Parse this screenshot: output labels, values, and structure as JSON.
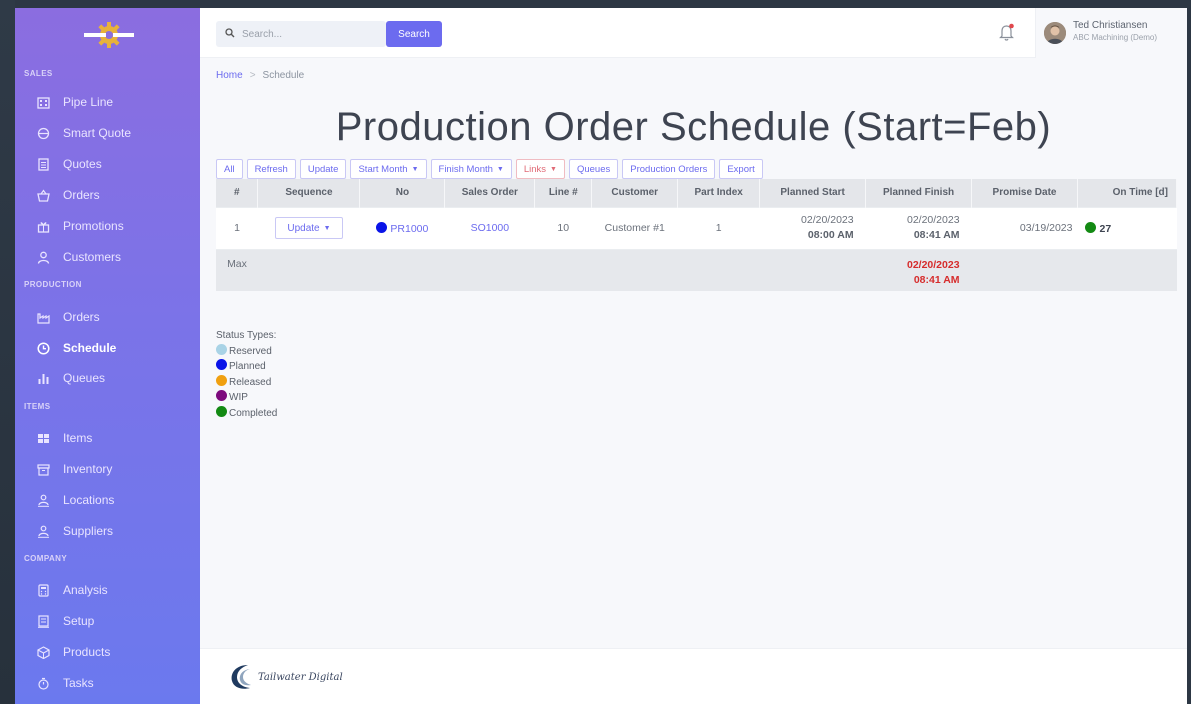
{
  "sidebar": {
    "sections": [
      {
        "label": "SALES"
      },
      {
        "label": "PRODUCTION"
      },
      {
        "label": "ITEMS"
      },
      {
        "label": "COMPANY"
      }
    ],
    "items": [
      {
        "label": "Pipe Line",
        "icon": "building-icon"
      },
      {
        "label": "Smart Quote",
        "icon": "smart-quote-icon"
      },
      {
        "label": "Quotes",
        "icon": "document-icon"
      },
      {
        "label": "Orders",
        "icon": "basket-icon"
      },
      {
        "label": "Promotions",
        "icon": "gift-icon"
      },
      {
        "label": "Customers",
        "icon": "person-icon"
      },
      {
        "label": "Orders",
        "icon": "factory-icon"
      },
      {
        "label": "Schedule",
        "icon": "clock-icon",
        "active": true
      },
      {
        "label": "Queues",
        "icon": "bar-chart-icon"
      },
      {
        "label": "Items",
        "icon": "boxes-icon"
      },
      {
        "label": "Inventory",
        "icon": "archive-icon"
      },
      {
        "label": "Locations",
        "icon": "location-person-icon"
      },
      {
        "label": "Suppliers",
        "icon": "supplier-icon"
      },
      {
        "label": "Analysis",
        "icon": "calculator-icon"
      },
      {
        "label": "Setup",
        "icon": "setup-icon"
      },
      {
        "label": "Products",
        "icon": "cube-icon"
      },
      {
        "label": "Tasks",
        "icon": "timer-icon"
      }
    ]
  },
  "header": {
    "search_placeholder": "Search...",
    "search_button": "Search",
    "user_name": "Ted Christiansen",
    "user_org": "ABC Machining (Demo)"
  },
  "breadcrumb": {
    "home": "Home",
    "sep": ">",
    "current": "Schedule"
  },
  "page_title": "Production Order Schedule (Start=Feb)",
  "toolbar": {
    "all": "All",
    "refresh": "Refresh",
    "update": "Update",
    "start_month": "Start Month",
    "finish_month": "Finish Month",
    "links": "Links",
    "queues": "Queues",
    "production_orders": "Production Orders",
    "export": "Export"
  },
  "table": {
    "columns": [
      "#",
      "Sequence",
      "No",
      "Sales Order",
      "Line #",
      "Customer",
      "Part Index",
      "Planned Start",
      "Planned Finish",
      "Promise Date",
      "On Time [d]"
    ],
    "rows": [
      {
        "num": "1",
        "sequence_button": "Update",
        "no": "PR1000",
        "status_color": "#0a14e8",
        "sales_order": "SO1000",
        "line": "10",
        "customer": "Customer #1",
        "part_index": "1",
        "planned_start_date": "02/20/2023",
        "planned_start_time": "08:00 AM",
        "planned_finish_date": "02/20/2023",
        "planned_finish_time": "08:41 AM",
        "promise_date": "03/19/2023",
        "on_time": "27",
        "on_time_color": "#138a13"
      }
    ],
    "max_row": {
      "label": "Max",
      "planned_finish_date": "02/20/2023",
      "planned_finish_time": "08:41 AM"
    }
  },
  "legend": {
    "title": "Status Types:",
    "items": [
      {
        "label": "Reserved",
        "color": "#a9d3e6"
      },
      {
        "label": "Planned",
        "color": "#0a14e8"
      },
      {
        "label": "Released",
        "color": "#f0a010"
      },
      {
        "label": "WIP",
        "color": "#7d0a7d"
      },
      {
        "label": "Completed",
        "color": "#138a13"
      }
    ]
  },
  "footer": {
    "brand": "Tailwater Digital"
  }
}
